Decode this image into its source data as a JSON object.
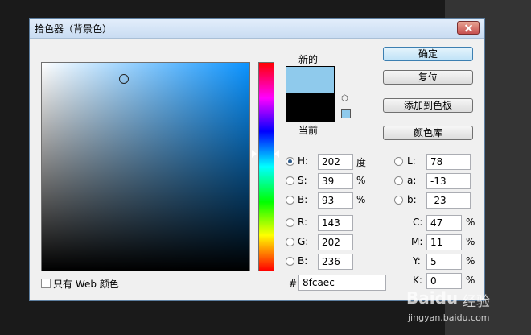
{
  "window": {
    "title": "拾色器（背景色）"
  },
  "preview": {
    "new_label": "新的",
    "current_label": "当前",
    "new_color": "#8fcaec",
    "current_color": "#000000"
  },
  "buttons": {
    "ok": "确定",
    "reset": "复位",
    "add_to_swatches": "添加到色板",
    "color_libraries": "颜色库"
  },
  "hsb": {
    "h": {
      "label": "H:",
      "value": "202",
      "unit": "度"
    },
    "s": {
      "label": "S:",
      "value": "39",
      "unit": "%"
    },
    "b": {
      "label": "B:",
      "value": "93",
      "unit": "%"
    }
  },
  "rgb": {
    "r": {
      "label": "R:",
      "value": "143"
    },
    "g": {
      "label": "G:",
      "value": "202"
    },
    "b": {
      "label": "B:",
      "value": "236"
    }
  },
  "lab": {
    "l": {
      "label": "L:",
      "value": "78"
    },
    "a": {
      "label": "a:",
      "value": "-13"
    },
    "b": {
      "label": "b:",
      "value": "-23"
    }
  },
  "cmyk": {
    "c": {
      "label": "C:",
      "value": "47",
      "unit": "%"
    },
    "m": {
      "label": "M:",
      "value": "11",
      "unit": "%"
    },
    "y": {
      "label": "Y:",
      "value": "5",
      "unit": "%"
    },
    "k": {
      "label": "K:",
      "value": "0",
      "unit": "%"
    }
  },
  "hex": {
    "label": "#",
    "value": "8fcaec"
  },
  "web_only": {
    "label": "只有 Web 颜色"
  },
  "watermark": {
    "brand": "Baidu",
    "suffix": "经验",
    "url": "jingyan.baidu.com"
  }
}
